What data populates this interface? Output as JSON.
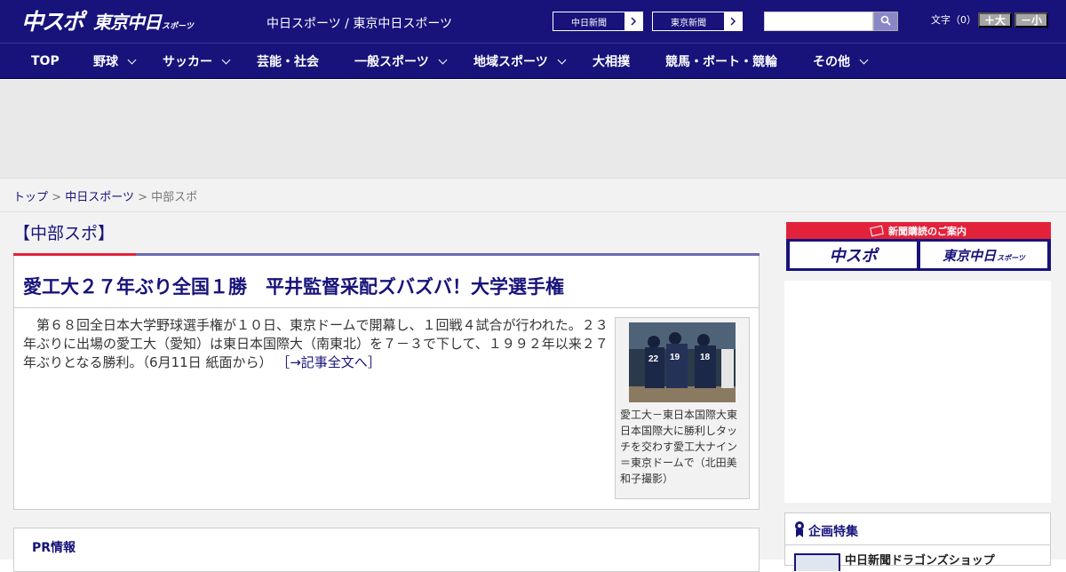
{
  "header": {
    "logo_chunichi": "中スポ",
    "logo_tokyo": "東京中日",
    "logo_sports": "スポーツ",
    "site_names": "中日スポーツ / 東京中日スポーツ",
    "links": [
      {
        "label": "中日新聞"
      },
      {
        "label": "東京新聞"
      }
    ],
    "search": {
      "value": "",
      "placeholder": ""
    },
    "font_size_label": "文字（0）",
    "font_larger": "＋大",
    "font_smaller": "－小"
  },
  "nav": [
    {
      "label": "TOP",
      "has_dropdown": false
    },
    {
      "label": "野球",
      "has_dropdown": true
    },
    {
      "label": "サッカー",
      "has_dropdown": true
    },
    {
      "label": "芸能・社会",
      "has_dropdown": false
    },
    {
      "label": "一般スポーツ",
      "has_dropdown": true
    },
    {
      "label": "地域スポーツ",
      "has_dropdown": true
    },
    {
      "label": "大相撲",
      "has_dropdown": false
    },
    {
      "label": "競馬・ボート・競輪",
      "has_dropdown": false
    },
    {
      "label": "その他",
      "has_dropdown": true
    }
  ],
  "breadcrumb": {
    "top": "トップ",
    "sep": ">",
    "chunichi": "中日スポーツ",
    "current": "中部スポ"
  },
  "section_title": "【中部スポ】",
  "article": {
    "title": "愛工大２７年ぶり全国１勝　平井監督采配ズバズバ！大学選手権",
    "body": "　第６８回全日本大学野球選手権が１０日、東京ドームで開幕し、１回戦４試合が行われた。２３年ぶりに出場の愛工大（愛知）は東日本国際大（南東北）を７－３で下して、１９９２年以来２７年ぶりとなる勝利。（6月11日 紙面から）",
    "more_link": "［→記事全文へ］",
    "photo_caption": "愛工大－東日本国際大東日本国際大に勝利しタッチを交わす愛工大ナイン＝東京ドームで（北田美和子撮影）",
    "photo_numbers": [
      "22",
      "19",
      "18"
    ]
  },
  "pr": {
    "title": "PR情報"
  },
  "sidebar": {
    "subscription_heading": "新聞購読のご案内",
    "subscription_logo_chunichi": "中スポ",
    "subscription_logo_tokyo": "東京中日",
    "subscription_logo_sports": "スポーツ",
    "feature_title": "企画特集",
    "feature_item": "中日新聞ドラゴンズショップ"
  },
  "colors": {
    "brand_navy": "#17137a",
    "accent_red": "#e2223b"
  }
}
